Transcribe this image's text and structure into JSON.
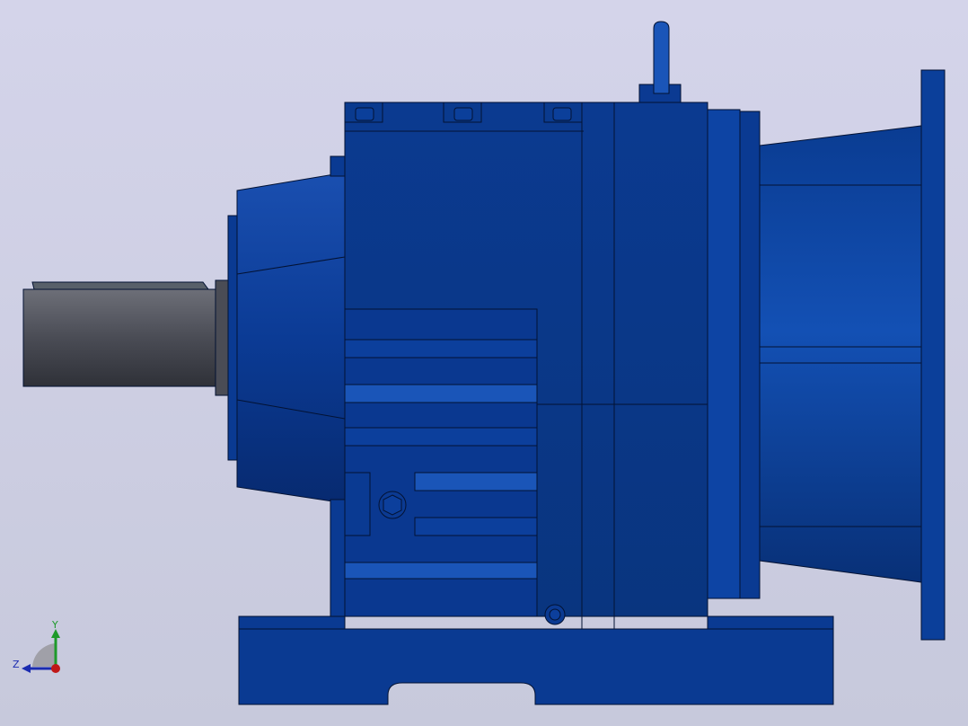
{
  "viewport": {
    "background_top": "#d4d4ea",
    "background_bottom": "#c7c9dc"
  },
  "model": {
    "body_color": "#0a3d96",
    "body_dark": "#072a6e",
    "body_light": "#1f5cc0",
    "shaft_color": "#5a5c66",
    "outline_color": "#031233"
  },
  "triad": {
    "y_label": "Y",
    "z_label": "Z",
    "y_color": "#1e9a2a",
    "z_color": "#1a2bb0",
    "x_color": "#c01818"
  }
}
